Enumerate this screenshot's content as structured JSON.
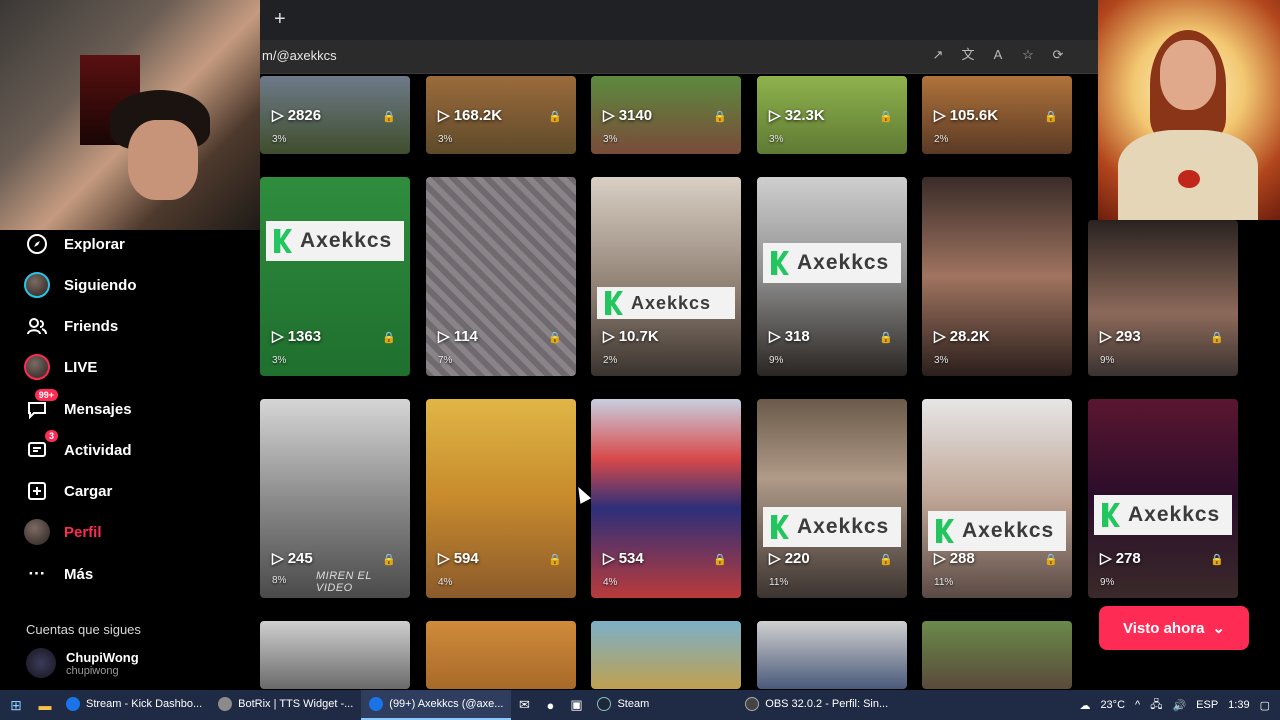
{
  "browser": {
    "new_tab_icon": "plus-icon",
    "url": "m/@axekkcs"
  },
  "sidebar": {
    "items": [
      {
        "label": "Explorar",
        "icon": "compass-icon"
      },
      {
        "label": "Siguiendo",
        "icon": "avatar"
      },
      {
        "label": "Friends",
        "icon": "users-icon"
      },
      {
        "label": "LIVE",
        "icon": "live-avatar"
      },
      {
        "label": "Mensajes",
        "icon": "message-icon",
        "badge": "99+"
      },
      {
        "label": "Actividad",
        "icon": "activity-icon",
        "badge": "3"
      },
      {
        "label": "Cargar",
        "icon": "upload-icon"
      },
      {
        "label": "Perfil",
        "icon": "profile-avatar"
      },
      {
        "label": "Más",
        "icon": "more-icon"
      }
    ],
    "following_title": "Cuentas que sigues",
    "following": [
      {
        "name": "ChupiWong",
        "handle": "chupiwong"
      }
    ]
  },
  "grid": {
    "row1": [
      {
        "views": "2826",
        "pct": "3%"
      },
      {
        "views": "168.2K",
        "pct": "3%"
      },
      {
        "views": "3140",
        "pct": "3%"
      },
      {
        "views": "32.3K",
        "pct": "3%"
      },
      {
        "views": "105.6K",
        "pct": "2%"
      }
    ],
    "row2": [
      {
        "views": "1363",
        "pct": "3%"
      },
      {
        "views": "114",
        "pct": "7%"
      },
      {
        "views": "10.7K",
        "pct": "2%"
      },
      {
        "views": "318",
        "pct": "9%"
      },
      {
        "views": "28.2K",
        "pct": "3%"
      },
      {
        "views": "293",
        "pct": "9%"
      }
    ],
    "row3": [
      {
        "views": "245",
        "pct": "8%",
        "caption": "MIREN EL VIDEO"
      },
      {
        "views": "594",
        "pct": "4%"
      },
      {
        "views": "534",
        "pct": "4%"
      },
      {
        "views": "220",
        "pct": "11%"
      },
      {
        "views": "288",
        "pct": "11%"
      },
      {
        "views": "278",
        "pct": "9%"
      }
    ],
    "logo_text": "Axekkcs"
  },
  "visto_ahora": "Visto ahora",
  "taskbar": {
    "tasks": [
      {
        "label": "Stream - Kick Dashbo...",
        "color": "#1b73e8"
      },
      {
        "label": "BotRix | TTS Widget -...",
        "color": "#8b8b8b"
      },
      {
        "label": "(99+) Axekkcs (@axe...",
        "color": "#1b73e8"
      },
      {
        "label": "Steam",
        "color": "#1b2838"
      },
      {
        "label": "OBS 32.0.2 - Perfil: Sin...",
        "color": "#444"
      }
    ],
    "weather": "23°C",
    "lang": "ESP",
    "time": "1:39"
  }
}
